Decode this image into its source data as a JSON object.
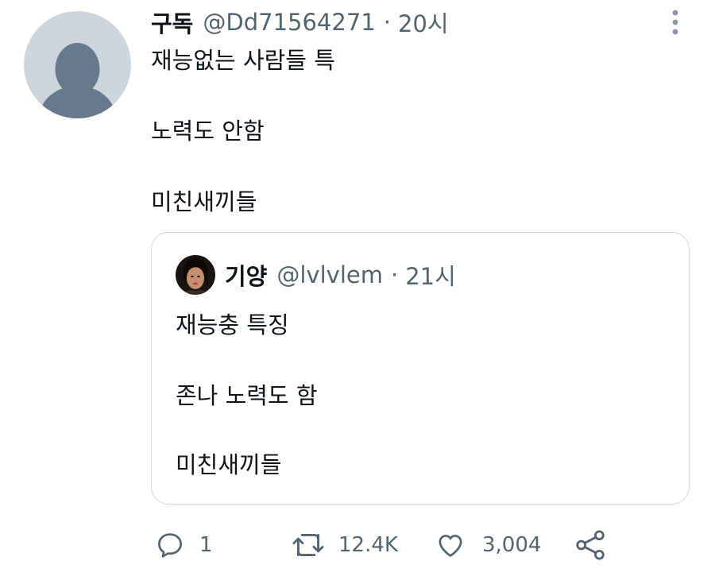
{
  "tweet": {
    "author_name": "구독",
    "handle": "@Dd71564271",
    "separator": "·",
    "time": "20시",
    "lines": [
      "재능없는 사람들 특",
      "노력도 안함",
      "미친새끼들"
    ]
  },
  "quoted_tweet": {
    "author_name": "기양",
    "handle": "@lvlvlem",
    "separator": "·",
    "time": "21시",
    "lines": [
      "재능충 특징",
      "존나 노력도 함",
      "미친새끼들"
    ]
  },
  "actions": {
    "reply_count": "1",
    "retweet_count": "12.4K",
    "like_count": "3,004"
  },
  "colors": {
    "text_primary": "#0f1419",
    "text_secondary": "#536471",
    "border": "#cfd9de",
    "avatar_placeholder_bg": "#ced5dc",
    "avatar_placeholder_fg": "#67798c"
  },
  "icons": [
    "default-avatar-icon",
    "more-options-icon",
    "reply-icon",
    "retweet-icon",
    "like-icon",
    "share-icon"
  ]
}
